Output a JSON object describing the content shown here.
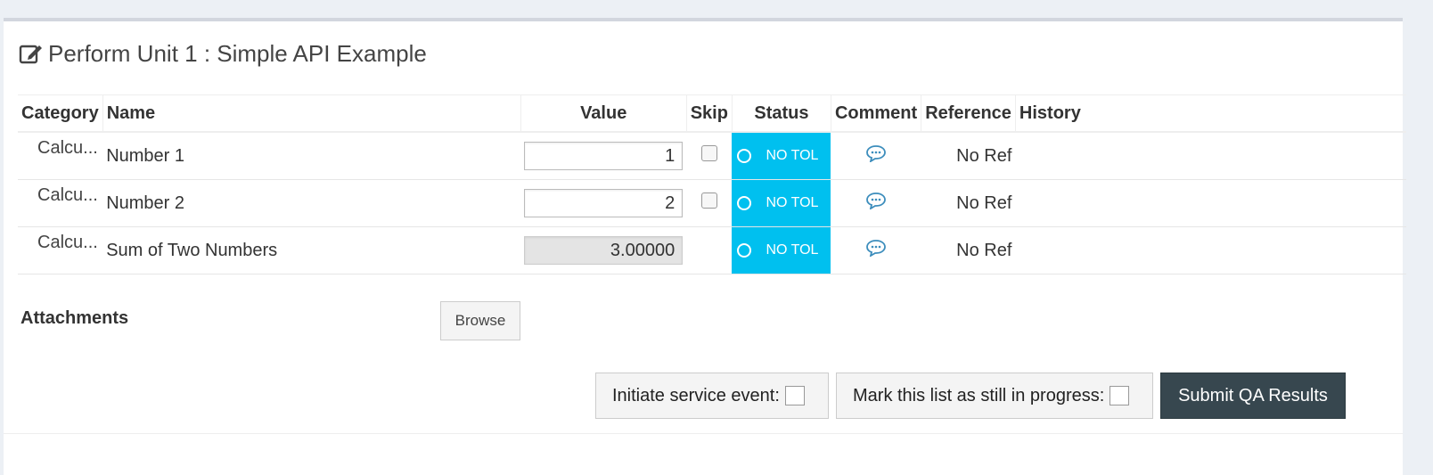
{
  "header": {
    "icon": "edit-icon",
    "title": "Perform Unit 1 : Simple API Example"
  },
  "table": {
    "columns": {
      "category": "Category",
      "name": "Name",
      "value": "Value",
      "skip": "Skip",
      "status": "Status",
      "comment": "Comment",
      "reference": "Reference",
      "history": "History"
    },
    "rows": [
      {
        "category": "Calcu...",
        "name": "Number 1",
        "value": "1",
        "status": "NO TOL",
        "reference": "No Ref"
      },
      {
        "category": "Calcu...",
        "name": "Number 2",
        "value": "2",
        "status": "NO TOL",
        "reference": "No Ref"
      },
      {
        "category": "Calcu...",
        "name": "Sum of Two Numbers",
        "value": "3.00000",
        "status": "NO TOL",
        "reference": "No Ref"
      }
    ]
  },
  "attachments": {
    "label": "Attachments",
    "browse_label": "Browse"
  },
  "actions": {
    "service_event_label": "Initiate service event:",
    "in_progress_label": "Mark this list as still in progress:",
    "submit_label": "Submit QA Results"
  },
  "colors": {
    "status_bg": "#00c0ef",
    "submit_bg": "#37474f",
    "comment_icon": "#3c8dbc"
  }
}
